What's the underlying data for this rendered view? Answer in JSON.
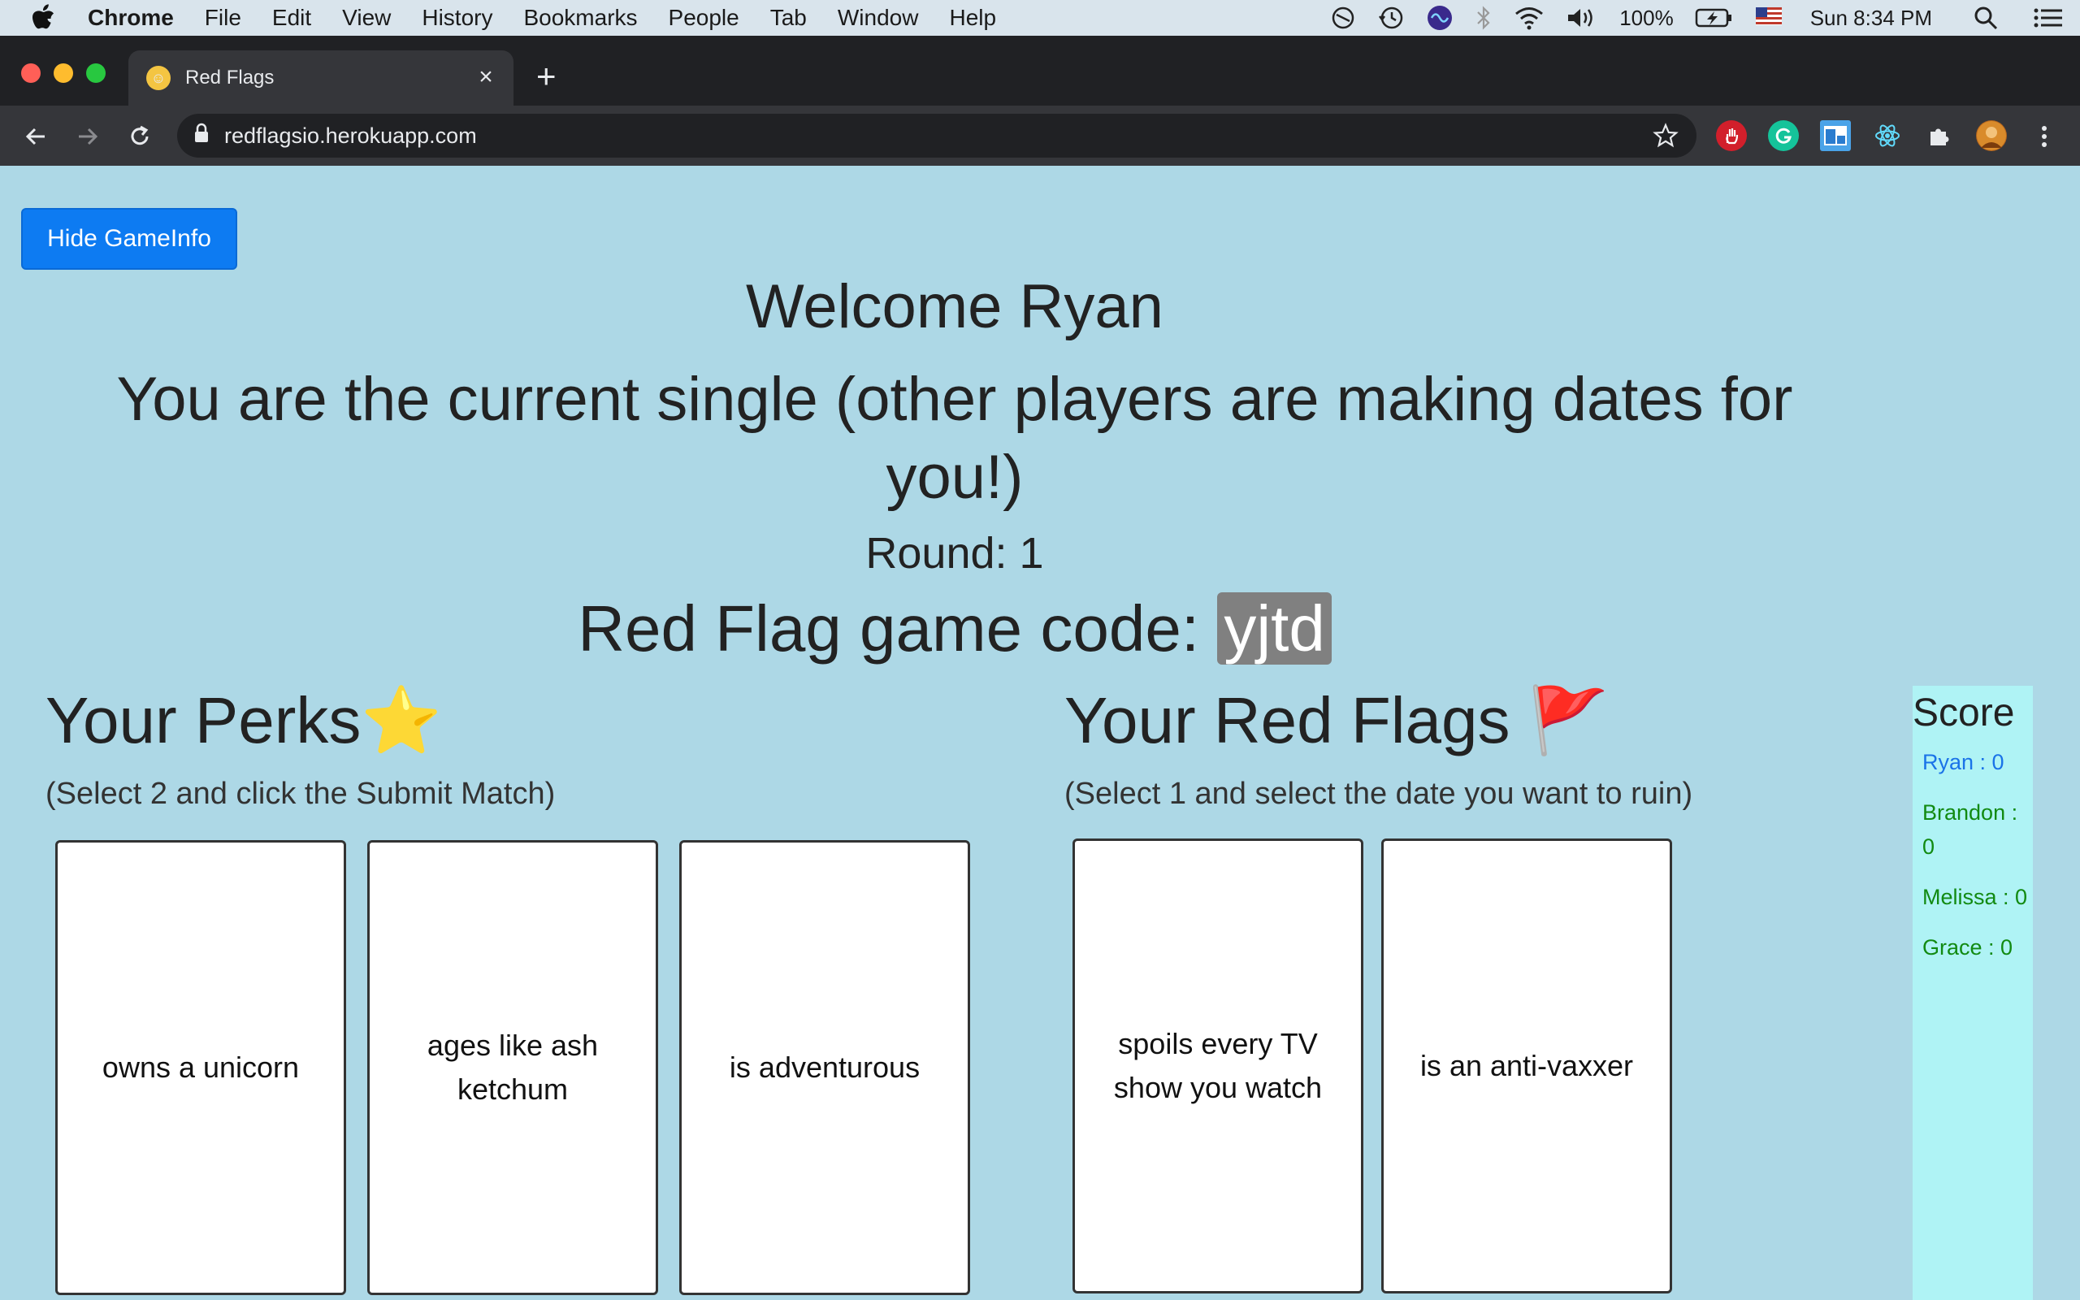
{
  "menubar": {
    "app": "Chrome",
    "items": [
      "File",
      "Edit",
      "View",
      "History",
      "Bookmarks",
      "People",
      "Tab",
      "Window",
      "Help"
    ],
    "battery": "100%",
    "clock": "Sun 8:34 PM"
  },
  "browser": {
    "tab_title": "Red Flags",
    "url": "redflagsio.herokuapp.com"
  },
  "page": {
    "hide_button": "Hide GameInfo",
    "welcome": "Welcome Ryan",
    "single_message": "You are the current single (other players are making dates for you!)",
    "round": "Round: 1",
    "game_code_label": "Red Flag game code:",
    "game_code": "yjtd",
    "perks_title": "Your Perks⭐",
    "perks_subtitle": "(Select 2 and click the Submit Match)",
    "perks": [
      "owns a unicorn",
      "ages like ash ketchum",
      "is adventurous"
    ],
    "flags_title": "Your Red Flags 🚩",
    "flags_subtitle": "(Select 1 and select the date you want to ruin)",
    "flags": [
      "spoils every TV show you watch",
      "is an anti-vaxxer"
    ],
    "score_title": "Score",
    "scores": [
      "Ryan : 0",
      "Brandon : 0",
      "Melissa : 0",
      "Grace : 0"
    ]
  },
  "colors": {
    "page_bg": "#add8e6",
    "button_blue": "#0d7bf2",
    "score_panel": "#aff3f5",
    "score_green": "#128a12",
    "score_blue": "#1a73e8"
  }
}
